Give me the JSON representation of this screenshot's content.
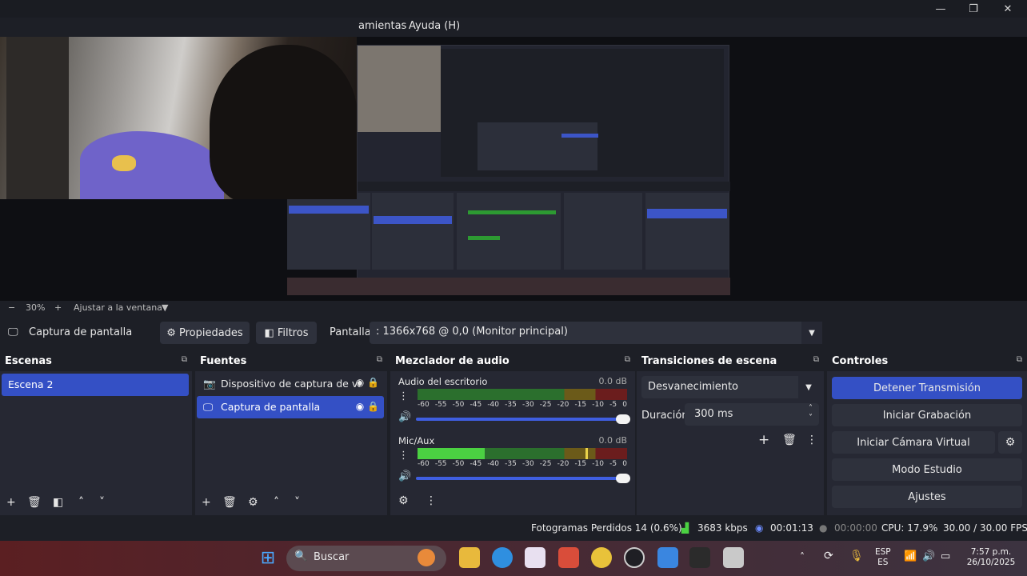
{
  "window": {
    "controls": {
      "minimize": "—",
      "maximize": "❐",
      "close": "✕"
    }
  },
  "menu": {
    "items": [
      "amientas",
      "Ayuda (H)"
    ]
  },
  "preview_scale": {
    "zoom": "30%",
    "fit_label": "Ajustar a la ventana",
    "minus": "−",
    "plus": "+"
  },
  "source_toolbar": {
    "source_name": "Captura de pantalla",
    "properties_label": "Propiedades",
    "filters_label": "Filtros",
    "display_label": "Pantalla",
    "display_value": ": 1366x768 @ 0,0 (Monitor principal)"
  },
  "docks": {
    "scenes": {
      "title": "Escenas",
      "items": [
        "Escena 2"
      ]
    },
    "sources": {
      "title": "Fuentes",
      "items": [
        "Dispositivo de captura de vi",
        "Captura de pantalla"
      ]
    },
    "mixer": {
      "title": "Mezclador de audio",
      "channels": [
        {
          "name": "Audio del escritorio",
          "db": "0.0 dB",
          "level": 0.0,
          "peak": 0.0
        },
        {
          "name": "Mic/Aux",
          "db": "0.0 dB",
          "level": 0.32,
          "peak": 0.8
        }
      ],
      "ticks": [
        "-60",
        "-55",
        "-50",
        "-45",
        "-40",
        "-35",
        "-30",
        "-25",
        "-20",
        "-15",
        "-10",
        "-5",
        "0"
      ]
    },
    "transitions": {
      "title": "Transiciones de escena",
      "transition": "Desvanecimiento",
      "duration_label": "Duración",
      "duration_value": "300 ms"
    },
    "controls": {
      "title": "Controles",
      "buttons": [
        "Detener Transmisión",
        "Iniciar Grabación",
        "Iniciar Cámara Virtual",
        "Modo Estudio",
        "Ajustes"
      ]
    }
  },
  "status": {
    "dropped_frames": "Fotogramas Perdidos 14 (0.6%)",
    "bitrate": "3683 kbps",
    "stream_time": "00:01:13",
    "record_time": "00:00:00",
    "cpu": "CPU: 17.9%",
    "fps": "30.00 / 30.00 FPS"
  },
  "taskbar": {
    "search_label": "Buscar",
    "lang": "ESP",
    "lang2": "ES",
    "time": "7:57 p.m.",
    "date": "26/10/2025"
  }
}
